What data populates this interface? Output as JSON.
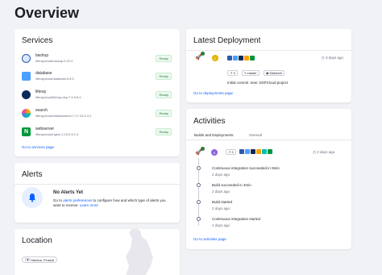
{
  "page": {
    "title": "Overview"
  },
  "services": {
    "title": "Services",
    "items": [
      {
        "name": "backup",
        "image": "liferaycloud/backup:5.22.0",
        "status": "Ready",
        "color": "#2e5aac"
      },
      {
        "name": "database",
        "image": "liferaycloud/database:5.8.0",
        "status": "Ready",
        "color": "#4b9fff"
      },
      {
        "name": "liferay",
        "image": "liferaycloud/liferay-dxp:7.4-5.8.0",
        "status": "Ready",
        "color": "#0b2a5c"
      },
      {
        "name": "search",
        "image": "liferaycloud/elasticsearch:7.17.23-5.3.2",
        "status": "Ready",
        "color": "#f5a300"
      },
      {
        "name": "webserver",
        "image": "liferaycloud/nginx:1.24.0-5.1.4",
        "status": "Ready",
        "color": "#009639"
      }
    ],
    "link": "Go to services page"
  },
  "alerts": {
    "title": "Alerts",
    "heading": "No Alerts Yet",
    "text_1": "Go to ",
    "link_1": "alerts preferences",
    "text_2": " to configure how and which type of alerts you",
    "text_3": "want to receive. ",
    "link_2": "Learn more"
  },
  "location": {
    "title": "Location",
    "chip": "Hamina, Finland"
  },
  "deployment": {
    "title": "Latest Deployment",
    "avatar": "C",
    "time": "3 days ago",
    "count": "3",
    "branch": "master",
    "commit": "65addc6",
    "message": "Initial commit :new: DXPCloud project",
    "link": "Go to deployments page"
  },
  "activities": {
    "title": "Activities",
    "tabs": [
      "Builds and Deployments",
      "General"
    ],
    "avatar": "K",
    "time": "2 days ago",
    "count": "3",
    "items": [
      {
        "text": "Continuous integration succeeded in ",
        "duration": "9min",
        "time": "2 days ago"
      },
      {
        "text": "Build succeeded in ",
        "duration": "3min",
        "time": "2 days ago"
      },
      {
        "text": "Build started",
        "duration": "",
        "time": "2 days ago"
      },
      {
        "text": "Continuous integration started",
        "duration": "",
        "time": "2 days ago"
      }
    ],
    "link": "Go to activities page"
  }
}
